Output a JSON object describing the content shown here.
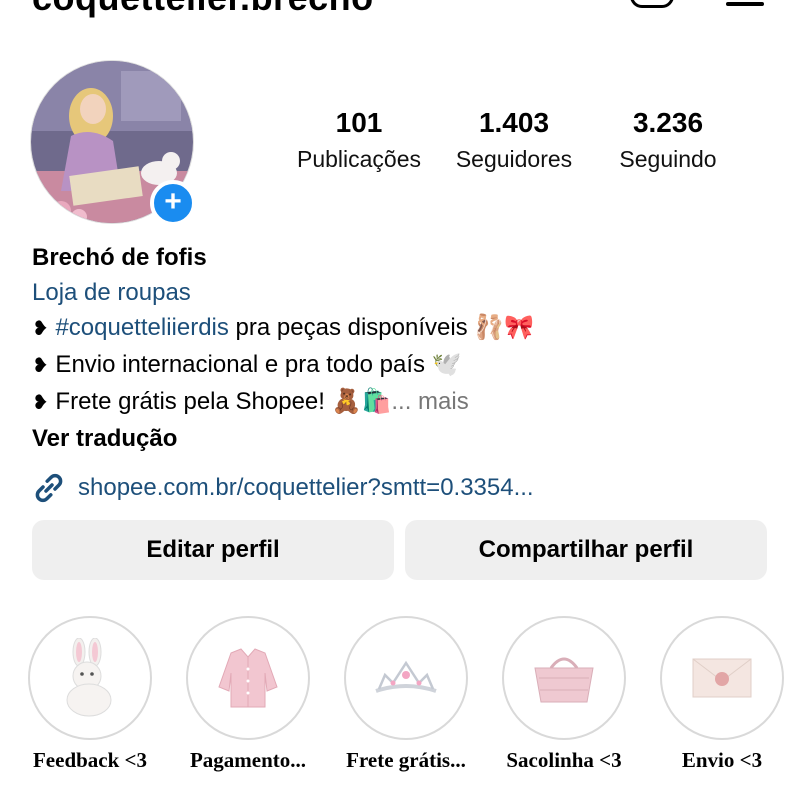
{
  "header": {
    "username": "coquettelier.brecho",
    "add_icon": "add-content-icon",
    "menu_icon": "hamburger-menu-icon"
  },
  "profile": {
    "avatar_icon": "profile-picture",
    "add_story_label": "+",
    "stats": [
      {
        "value": "101",
        "label": "Publicações"
      },
      {
        "value": "1.403",
        "label": "Seguidores"
      },
      {
        "value": "3.236",
        "label": "Seguindo"
      }
    ]
  },
  "bio": {
    "name": "Brechó de fofis",
    "category": "Loja de roupas",
    "bullet": "❥",
    "line1_hashtag": "#coquetteliierdis",
    "line1_text": " pra peças disponíveis 🩰🎀",
    "line2_text": " Envio internacional e pra todo país 🕊️",
    "line3_text": " Frete grátis pela Shopee! 🧸🛍️",
    "line3_more": "... mais",
    "translate": "Ver tradução"
  },
  "link": {
    "icon": "link-icon",
    "text": "shopee.com.br/coquettelier?smtt=0.3354..."
  },
  "buttons": {
    "edit": "Editar perfil",
    "share": "Compartilhar perfil"
  },
  "highlights": [
    {
      "label": "Feedback <3",
      "icon": "bunny-plush-icon"
    },
    {
      "label": "Pagamento...",
      "icon": "pink-cardigan-icon"
    },
    {
      "label": "Frete grátis...",
      "icon": "tiara-icon"
    },
    {
      "label": "Sacolinha <3",
      "icon": "basket-icon"
    },
    {
      "label": "Envio <3",
      "icon": "envelope-icon"
    }
  ],
  "colors": {
    "link_blue": "#1d4f7a",
    "badge_blue": "#1a8cf0",
    "button_gray": "#efefef"
  }
}
